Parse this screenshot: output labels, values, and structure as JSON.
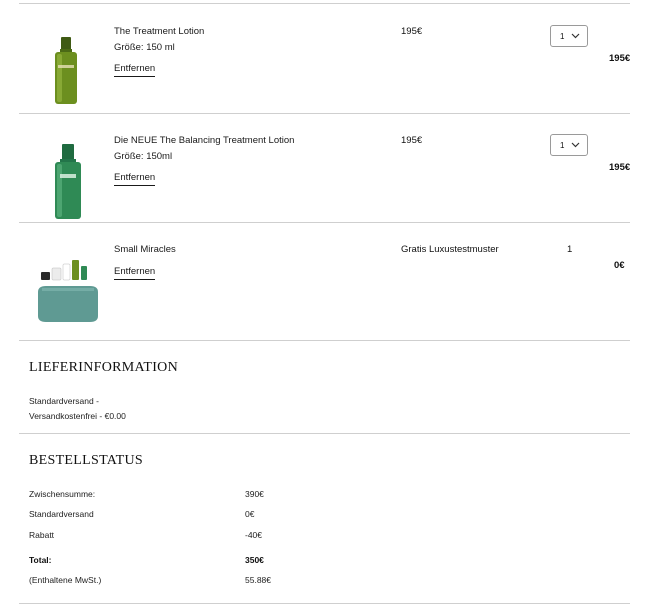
{
  "cart": {
    "items": [
      {
        "name": "The Treatment Lotion",
        "size": "Größe: 150 ml",
        "remove_label": "Entfernen",
        "unit_price": "195€",
        "quantity": "1",
        "line_total": "195€",
        "image": "green-bottle-image"
      },
      {
        "name": "Die NEUE The Balancing Treatment Lotion",
        "size": "Größe: 150ml",
        "remove_label": "Entfernen",
        "unit_price": "195€",
        "quantity": "1",
        "line_total": "195€",
        "image": "emerald-bottle-image"
      },
      {
        "name": "Small Miracles",
        "remove_label": "Entfernen",
        "unit_price": "Gratis Luxustestmuster",
        "quantity": "1",
        "line_total": "0€",
        "image": "gift-set-image"
      }
    ]
  },
  "delivery": {
    "title": "LIEFERINFORMATION",
    "line1": "Standardversand -",
    "line2": "Versandkostenfrei - €0.00"
  },
  "order_status": {
    "title": "BESTELLSTATUS",
    "rows": [
      {
        "label": "Zwischensumme:",
        "value": "390€"
      },
      {
        "label": "Standardversand",
        "value": "0€"
      },
      {
        "label": "Rabatt",
        "value": "-40€"
      },
      {
        "label": "Total:",
        "value": "350€"
      },
      {
        "label": "(Enthaltene MwSt.)",
        "value": "55.88€"
      }
    ]
  },
  "colors": {
    "divider": "#cfcfcf",
    "bottle_green": "#6c8f1f",
    "bottle_emerald": "#2f8a55",
    "pouch_teal": "#5f9a93"
  }
}
